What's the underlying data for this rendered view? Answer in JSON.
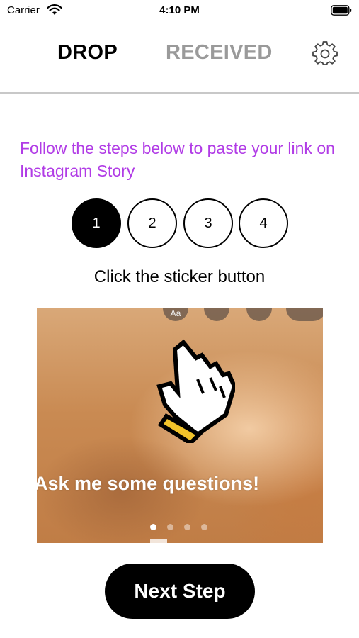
{
  "status_bar": {
    "carrier": "Carrier",
    "time": "4:10 PM",
    "wifi_icon": "wifi-icon",
    "battery_icon": "battery-icon"
  },
  "nav": {
    "tabs": [
      {
        "label": "DROP",
        "selected": true
      },
      {
        "label": "RECEIVED",
        "selected": false
      }
    ],
    "settings_icon": "gear-icon"
  },
  "instructions": "Follow the steps below to paste your link on Instagram Story",
  "steps": [
    {
      "label": "1",
      "active": true
    },
    {
      "label": "2",
      "active": false
    },
    {
      "label": "3",
      "active": false
    },
    {
      "label": "4",
      "active": false
    }
  ],
  "current_step_title": "Click the sticker button",
  "preview": {
    "tool_labels": [
      "Aa",
      "",
      "",
      ""
    ],
    "caption": "Ask me some questions!",
    "page_count": 4,
    "current_page": 1,
    "pointer_icon": "hand-pointer-icon"
  },
  "next_button_label": "Next Step",
  "colors": {
    "instructions_text": "#b13ce6",
    "inactive_tab": "#9a9a9a",
    "primary": "#000000"
  }
}
